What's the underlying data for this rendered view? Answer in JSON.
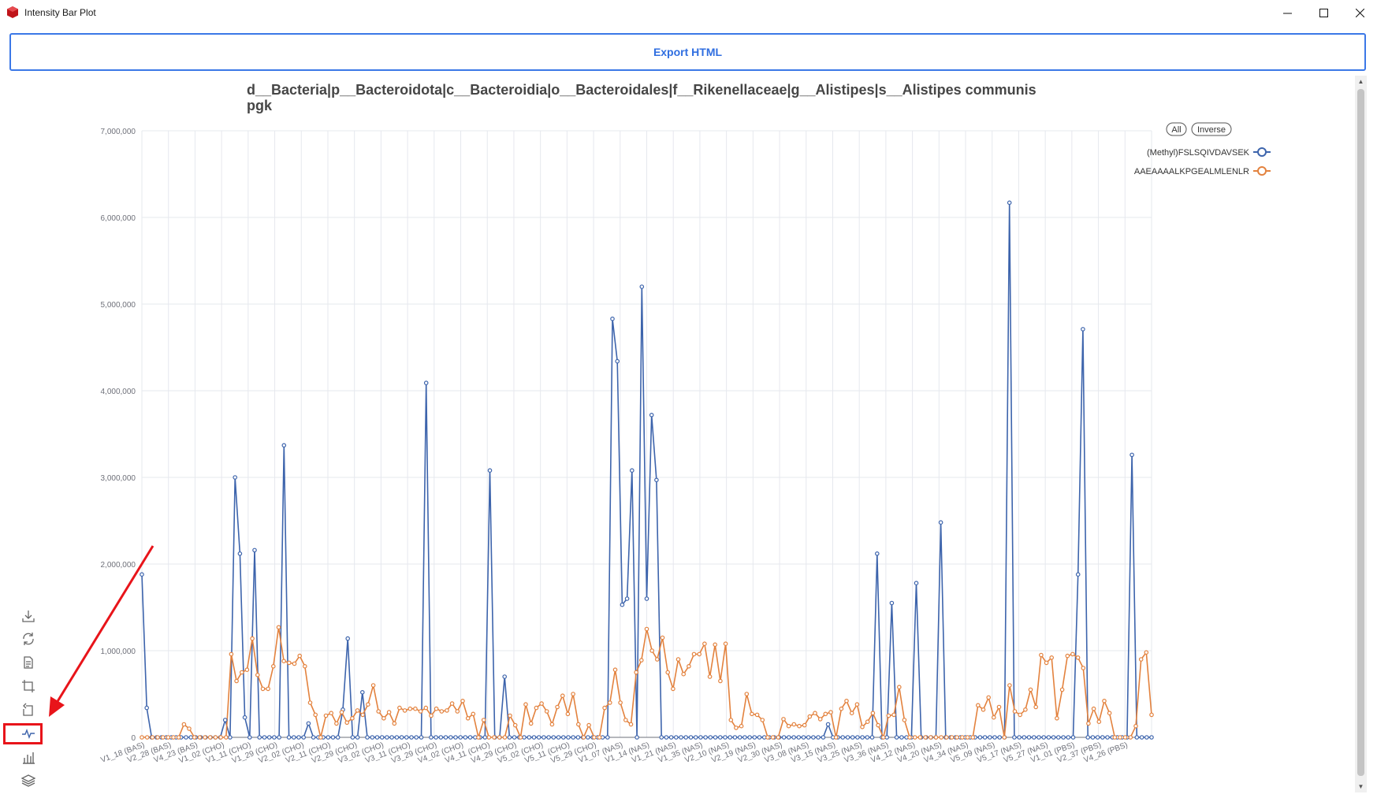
{
  "window": {
    "title": "Intensity Bar Plot"
  },
  "toolbar": {
    "export_label": "Export HTML"
  },
  "chart_data": {
    "type": "line",
    "title": "d__Bacteria|p__Bacteroidota|c__Bacteroidia|o__Bacteroidales|f__Rikenellaceae|g__Alistipes|s__Alistipes communis",
    "subtitle": "pgk",
    "xlabel": "",
    "ylabel": "",
    "ylim": [
      0,
      7000000
    ],
    "yticks": [
      "0",
      "1,000,000",
      "2,000,000",
      "3,000,000",
      "4,000,000",
      "5,000,000",
      "6,000,000",
      "7,000,000"
    ],
    "x_tick_labels": [
      "V1_18 (BAS)",
      "V2_28 (BAS)",
      "V4_23 (BAS)",
      "V1_02 (CHO)",
      "V1_11 (CHO)",
      "V1_29 (CHO)",
      "V2_02 (CHO)",
      "V2_11 (CHO)",
      "V2_29 (CHO)",
      "V3_02 (CHO)",
      "V3_11 (CHO)",
      "V3_29 (CHO)",
      "V4_02 (CHO)",
      "V4_11 (CHO)",
      "V4_29 (CHO)",
      "V5_02 (CHO)",
      "V5_11 (CHO)",
      "V5_29 (CHO)",
      "V1_07 (NAS)",
      "V1_14 (NAS)",
      "V1_21 (NAS)",
      "V1_35 (NAS)",
      "V2_10 (NAS)",
      "V2_19 (NAS)",
      "V2_30 (NAS)",
      "V3_08 (NAS)",
      "V3_15 (NAS)",
      "V3_25 (NAS)",
      "V3_36 (NAS)",
      "V4_12 (NAS)",
      "V4_20 (NAS)",
      "V4_34 (NAS)",
      "V5_09 (NAS)",
      "V5_17 (NAS)",
      "V5_27 (NAS)",
      "V1_01 (PBS)",
      "V2_37 (PBS)",
      "V4_26 (PBS)"
    ],
    "grid": true,
    "legend": {
      "position": "top-right",
      "all_label": "All",
      "inverse_label": "Inverse"
    },
    "series": [
      {
        "name": "(Methyl)FSLSQIVDAVSEK",
        "color": "#3d64ac",
        "values": [
          1880000,
          340000,
          0,
          0,
          0,
          0,
          0,
          0,
          0,
          0,
          0,
          0,
          0,
          0,
          0,
          0,
          0,
          200000,
          0,
          3000000,
          2120000,
          230000,
          0,
          2160000,
          0,
          0,
          0,
          0,
          0,
          3370000,
          0,
          0,
          0,
          0,
          160000,
          0,
          0,
          0,
          0,
          0,
          0,
          320000,
          1140000,
          0,
          0,
          520000,
          0,
          0,
          0,
          0,
          0,
          0,
          0,
          0,
          0,
          0,
          0,
          0,
          4090000,
          0,
          0,
          0,
          0,
          0,
          0,
          0,
          0,
          0,
          0,
          0,
          0,
          3080000,
          0,
          0,
          700000,
          0,
          0,
          0,
          0,
          0,
          0,
          0,
          0,
          0,
          0,
          0,
          0,
          0,
          0,
          0,
          0,
          0,
          0,
          0,
          0,
          0,
          4830000,
          4340000,
          1530000,
          1600000,
          3080000,
          0,
          5200000,
          1600000,
          3720000,
          2970000,
          0,
          0,
          0,
          0,
          0,
          0,
          0,
          0,
          0,
          0,
          0,
          0,
          0,
          0,
          0,
          0,
          0,
          0,
          0,
          0,
          0,
          0,
          0,
          0,
          0,
          0,
          0,
          0,
          0,
          0,
          0,
          0,
          0,
          0,
          150000,
          0,
          0,
          0,
          0,
          0,
          0,
          0,
          0,
          0,
          2120000,
          0,
          0,
          1550000,
          0,
          0,
          0,
          0,
          1780000,
          0,
          0,
          0,
          0,
          2480000,
          0,
          0,
          0,
          0,
          0,
          0,
          0,
          0,
          0,
          0,
          0,
          0,
          0,
          6170000,
          0,
          0,
          0,
          0,
          0,
          0,
          0,
          0,
          0,
          0,
          0,
          0,
          0,
          1880000,
          4710000,
          0,
          0,
          0,
          0,
          0,
          0,
          0,
          0,
          0,
          3260000,
          0,
          0,
          0,
          0
        ]
      },
      {
        "name": "AAEAAAALKPGEALMLENLR",
        "color": "#e3823e",
        "values": [
          0,
          0,
          0,
          0,
          0,
          0,
          0,
          0,
          150000,
          100000,
          0,
          0,
          0,
          0,
          0,
          0,
          0,
          960000,
          650000,
          750000,
          780000,
          1140000,
          720000,
          560000,
          560000,
          820000,
          1270000,
          880000,
          860000,
          850000,
          940000,
          820000,
          400000,
          260000,
          0,
          250000,
          280000,
          160000,
          290000,
          170000,
          220000,
          310000,
          260000,
          380000,
          600000,
          300000,
          220000,
          290000,
          160000,
          340000,
          310000,
          330000,
          330000,
          300000,
          340000,
          250000,
          330000,
          300000,
          310000,
          390000,
          300000,
          420000,
          220000,
          270000,
          0,
          200000,
          0,
          0,
          0,
          0,
          250000,
          140000,
          0,
          380000,
          160000,
          340000,
          390000,
          300000,
          150000,
          350000,
          480000,
          270000,
          500000,
          150000,
          0,
          140000,
          0,
          0,
          340000,
          400000,
          780000,
          400000,
          200000,
          150000,
          750000,
          890000,
          1250000,
          1000000,
          900000,
          1150000,
          750000,
          560000,
          900000,
          730000,
          820000,
          960000,
          960000,
          1080000,
          700000,
          1070000,
          650000,
          1080000,
          200000,
          110000,
          130000,
          500000,
          270000,
          260000,
          200000,
          0,
          0,
          0,
          210000,
          130000,
          150000,
          130000,
          140000,
          240000,
          280000,
          210000,
          270000,
          290000,
          0,
          330000,
          420000,
          280000,
          380000,
          120000,
          180000,
          280000,
          140000,
          0,
          250000,
          260000,
          580000,
          200000,
          0,
          0,
          0,
          0,
          0,
          0,
          0,
          0,
          0,
          0,
          0,
          0,
          0,
          370000,
          320000,
          460000,
          230000,
          350000,
          0,
          600000,
          300000,
          260000,
          320000,
          550000,
          350000,
          950000,
          860000,
          920000,
          220000,
          550000,
          940000,
          960000,
          920000,
          800000,
          160000,
          330000,
          180000,
          420000,
          280000,
          0,
          0,
          0,
          0,
          130000,
          900000,
          980000,
          260000
        ]
      }
    ]
  },
  "sidebar_tools": [
    {
      "icon": "download-icon"
    },
    {
      "icon": "refresh-icon"
    },
    {
      "icon": "data-view-icon"
    },
    {
      "icon": "zoom-select-icon"
    },
    {
      "icon": "zoom-reset-icon"
    },
    {
      "icon": "line-chart-icon"
    },
    {
      "icon": "bar-chart-icon"
    },
    {
      "icon": "stack-icon"
    }
  ],
  "annotation": {
    "color": "#e8141a"
  }
}
